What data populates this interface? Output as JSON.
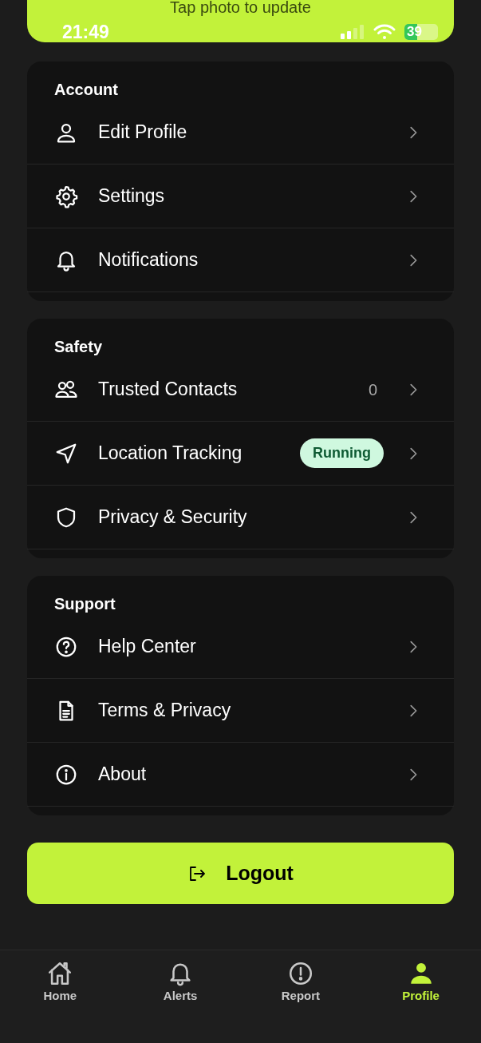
{
  "header": {
    "hint": "Tap photo to update"
  },
  "status_bar": {
    "time": "21:49",
    "battery": "39"
  },
  "sections": [
    {
      "title": "Account",
      "items": [
        {
          "label": "Edit Profile"
        },
        {
          "label": "Settings"
        },
        {
          "label": "Notifications"
        }
      ]
    },
    {
      "title": "Safety",
      "items": [
        {
          "label": "Trusted Contacts",
          "count": "0"
        },
        {
          "label": "Location Tracking",
          "badge": "Running"
        },
        {
          "label": "Privacy & Security"
        }
      ]
    },
    {
      "title": "Support",
      "items": [
        {
          "label": "Help Center"
        },
        {
          "label": "Terms & Privacy"
        },
        {
          "label": "About"
        }
      ]
    }
  ],
  "logout_button": {
    "label": "Logout"
  },
  "tab_bar": [
    {
      "label": "Home",
      "selected": false
    },
    {
      "label": "Alerts",
      "selected": false
    },
    {
      "label": "Report",
      "selected": false
    },
    {
      "label": "Profile",
      "selected": true
    }
  ]
}
